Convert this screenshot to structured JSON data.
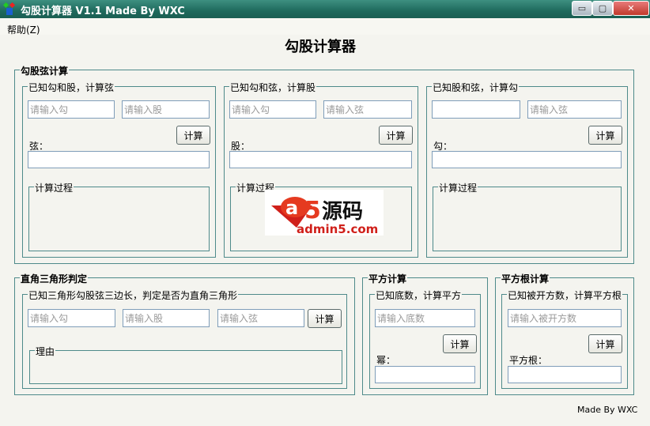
{
  "window": {
    "title": "勾股计算器 V1.1 Made By WXC",
    "min": "▭",
    "max": "▢",
    "close": "✕"
  },
  "menu": {
    "help": "帮助(Z)"
  },
  "heading": "勾股计算器",
  "pyth": {
    "title": "勾股弦计算",
    "panels": [
      {
        "title": "已知勾和股，计算弦",
        "ph1": "请输入勾",
        "ph2": "请输入股",
        "button": "计算",
        "result_label": "弦：",
        "process": "计算过程"
      },
      {
        "title": "已知勾和弦，计算股",
        "ph1": "请输入勾",
        "ph2": "请输入弦",
        "button": "计算",
        "result_label": "股：",
        "process": "计算过程"
      },
      {
        "title": "已知股和弦，计算勾",
        "ph1": "",
        "ph2": "请输入弦",
        "button": "计算",
        "result_label": "勾：",
        "process": "计算过程"
      }
    ]
  },
  "right": {
    "title": "直角三角形判定",
    "sub": "已知三角形勾股弦三边长，判定是否为直角三角形",
    "ph1": "请输入勾",
    "ph2": "请输入股",
    "ph3": "请输入弦",
    "button": "计算",
    "reason": "理由"
  },
  "square": {
    "title": "平方计算",
    "sub": "已知底数，计算平方",
    "ph": "请输入底数",
    "button": "计算",
    "result_label": "幂："
  },
  "sqrt": {
    "title": "平方根计算",
    "sub": "已知被开方数，计算平方根",
    "ph": "请输入被开方数",
    "button": "计算",
    "result_label": "平方根："
  },
  "watermark": {
    "brand": "源码",
    "url": "admin5.com"
  },
  "footer": "Made By WXC"
}
